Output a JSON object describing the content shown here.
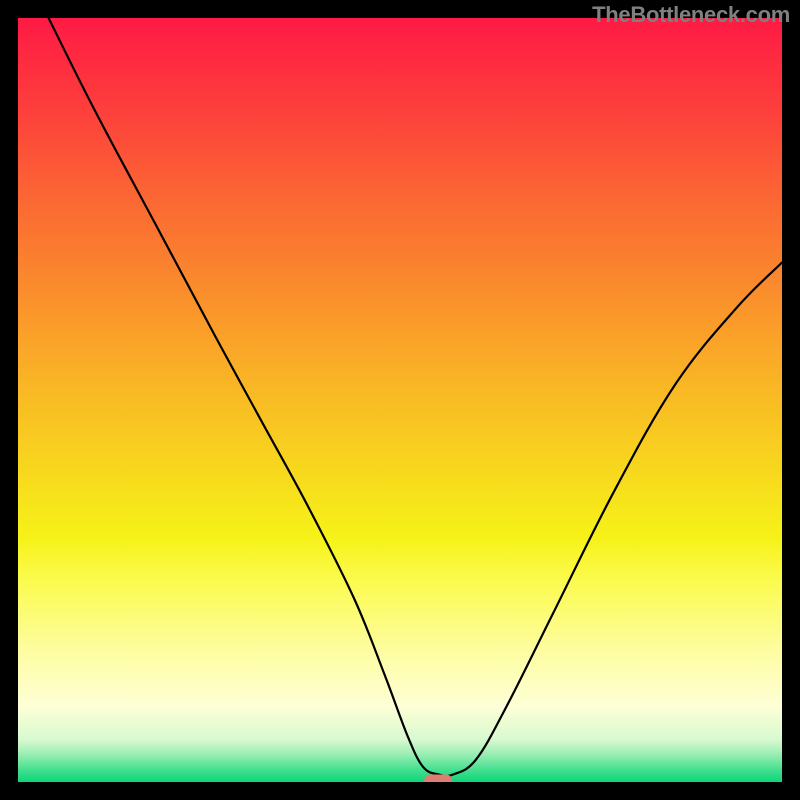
{
  "watermark": "TheBottleneck.com",
  "chart_data": {
    "type": "line",
    "title": "",
    "xlabel": "",
    "ylabel": "",
    "xlim": [
      0,
      100
    ],
    "ylim": [
      0,
      100
    ],
    "grid": false,
    "series": [
      {
        "name": "curve",
        "x": [
          4,
          10,
          18,
          26,
          32,
          38,
          44,
          48,
          51,
          53,
          55,
          57,
          60,
          64,
          70,
          78,
          86,
          94,
          100
        ],
        "values": [
          100,
          88,
          73,
          58,
          47,
          36,
          24,
          14,
          6,
          2,
          1,
          1,
          3,
          10,
          22,
          38,
          52,
          62,
          68
        ]
      }
    ],
    "marker": {
      "name": "pill-marker",
      "x": 55,
      "y": 0.2,
      "color": "#dd7e73"
    },
    "background_gradient": {
      "stops": [
        {
          "offset": 0.0,
          "color": "#fe1a44"
        },
        {
          "offset": 0.12,
          "color": "#fd3f3c"
        },
        {
          "offset": 0.24,
          "color": "#fb6833"
        },
        {
          "offset": 0.36,
          "color": "#fa8e2c"
        },
        {
          "offset": 0.48,
          "color": "#f9b625"
        },
        {
          "offset": 0.6,
          "color": "#f7da1d"
        },
        {
          "offset": 0.68,
          "color": "#f6f218"
        },
        {
          "offset": 0.74,
          "color": "#fbfb52"
        },
        {
          "offset": 0.83,
          "color": "#fdfda2"
        },
        {
          "offset": 0.9,
          "color": "#feffd6"
        },
        {
          "offset": 0.945,
          "color": "#d8f9d0"
        },
        {
          "offset": 0.965,
          "color": "#95edb1"
        },
        {
          "offset": 0.985,
          "color": "#40df8e"
        },
        {
          "offset": 1.0,
          "color": "#0dd679"
        }
      ]
    }
  }
}
